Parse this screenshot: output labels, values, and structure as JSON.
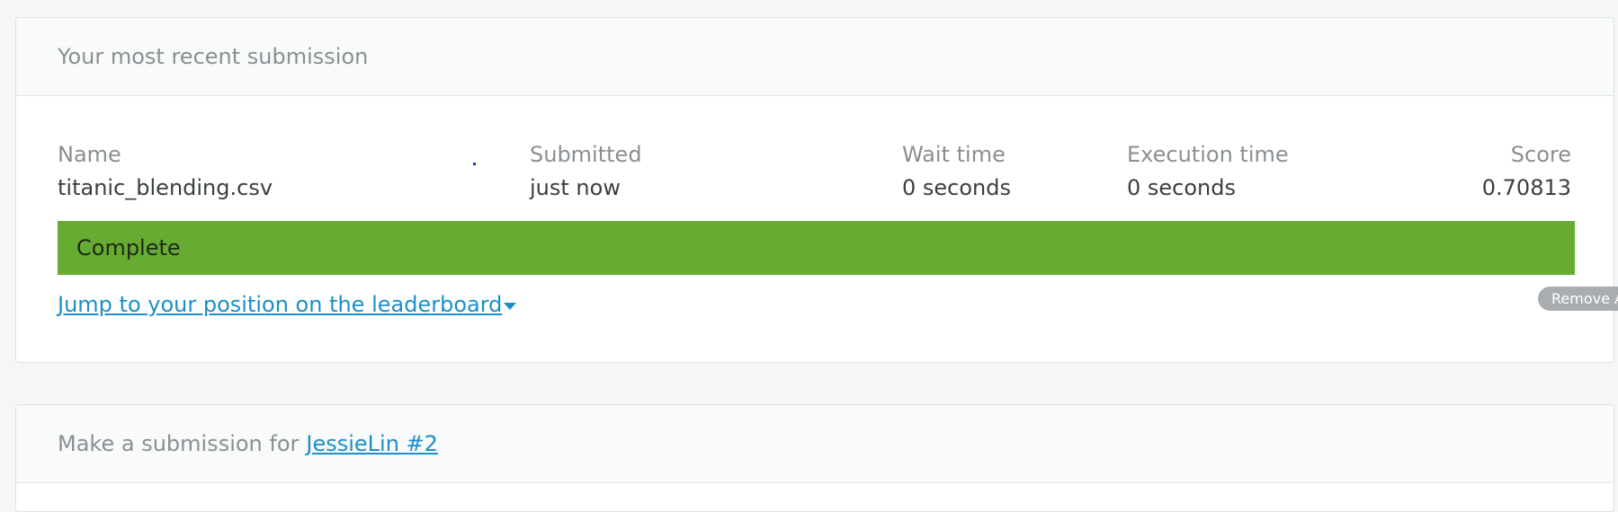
{
  "recent_submission": {
    "header": "Your most recent submission",
    "columns": {
      "name": "Name",
      "submitted": "Submitted",
      "wait_time": "Wait time",
      "execution_time": "Execution time",
      "score": "Score"
    },
    "row": {
      "name": "titanic_blending.csv",
      "submitted": "just now",
      "wait_time": "0 seconds",
      "execution_time": "0 seconds",
      "score": "0.70813"
    },
    "status": "Complete",
    "status_color": "#67ab33",
    "jump_link": "Jump to your position on the leaderboard",
    "jump_icon": "caret-down-icon"
  },
  "remove_button": "Remove A",
  "make_submission": {
    "prefix": "Make a submission for",
    "team_link": "JessieLin #2"
  },
  "colors": {
    "link": "#1b8fc9",
    "muted_text": "#8a8f93",
    "body_text": "#3a3f42",
    "page_background": "#f4f6f7"
  }
}
